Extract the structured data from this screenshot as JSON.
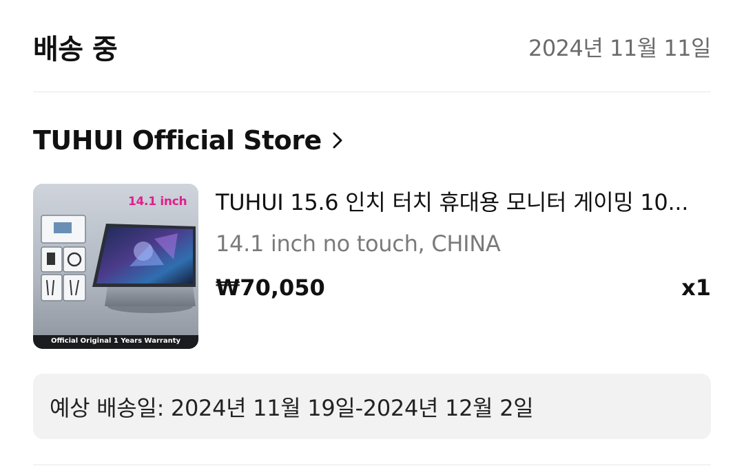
{
  "header": {
    "status": "배송 중",
    "date": "2024년 11월 11일"
  },
  "store": {
    "name": "TUHUI Official Store",
    "chevron_icon": "chevron-right-icon"
  },
  "product": {
    "title": "TUHUI 15.6 인치 터치 휴대용 모니터 게이밍 10...",
    "variant": "14.1 inch no touch, CHINA",
    "price": "₩70,050",
    "quantity": "x1",
    "image": {
      "badge_text": "14.1 inch",
      "banner_text": "Official Original 1 Years Warranty"
    }
  },
  "delivery": {
    "text": "예상 배송일: 2024년 11월 19일-2024년 12월 2일"
  },
  "colors": {
    "badge_pink": "#e0208c",
    "muted_text": "#6b6b6b",
    "box_bg": "#f2f2f2"
  }
}
